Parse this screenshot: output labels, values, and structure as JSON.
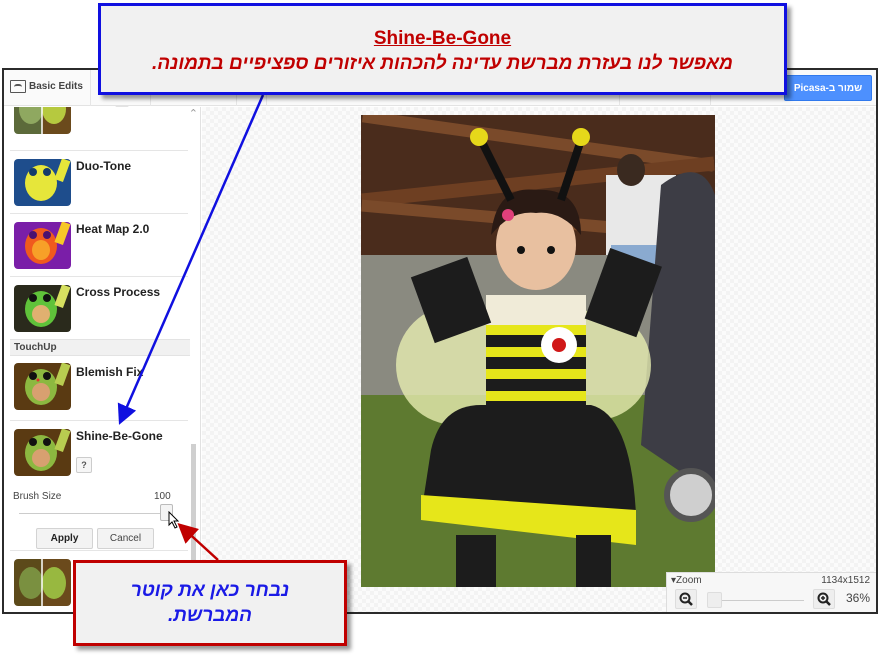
{
  "toolbar": {
    "basic_edits_label": "Basic Edits",
    "save_button_label": "שמור ב-Picasa"
  },
  "panel": {
    "effects_top": [
      {
        "label": "Duo-Tone",
        "thumb": "duotone"
      },
      {
        "label": "Heat Map 2.0",
        "thumb": "heatmap"
      },
      {
        "label": "Cross Process",
        "thumb": "crossprocess"
      }
    ],
    "section_touchup": "TouchUp",
    "effects_touchup": [
      {
        "label": "Blemish Fix",
        "thumb": "natural"
      },
      {
        "label": "Shine-Be-Gone",
        "thumb": "natural",
        "help_label": "?"
      }
    ],
    "brush_size_label": "Brush Size",
    "brush_size_value": "100",
    "brush_size_fraction": 1.0,
    "apply_label": "Apply",
    "cancel_label": "Cancel"
  },
  "zoom": {
    "title": "Zoom",
    "dimensions": "1134x1512",
    "percent": "36%",
    "slider_fraction": 0.0
  },
  "annotations": {
    "top_title": "Shine-Be-Gone",
    "top_description": "מאפשר לנו בעזרת מברשת עדינה להכהות איזורים ספציפיים בתמונה.",
    "bottom_line1": "נבחר כאן את קוטר",
    "bottom_line2": "המברשת.",
    "top_border_color": "#1010e0",
    "bottom_border_color": "#c00000"
  },
  "colors": {
    "save_button": "#4d90fe",
    "annotation_red_text": "#c00000",
    "annotation_blue_text": "#1a1ae6"
  }
}
